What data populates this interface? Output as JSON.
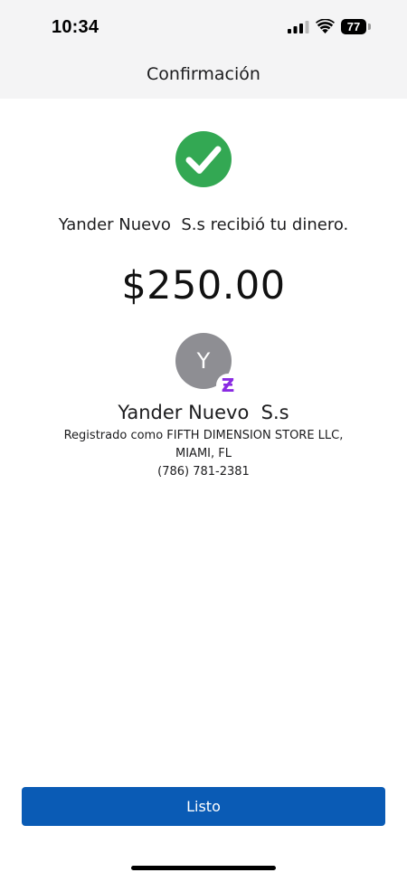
{
  "status_bar": {
    "time": "10:34",
    "battery": "77",
    "icons": [
      "signal-icon",
      "wifi-icon",
      "battery-icon"
    ]
  },
  "header": {
    "title": "Confirmación"
  },
  "confirmation": {
    "icon": "check-circle-icon",
    "icon_color": "#33a853",
    "message": "Yander Nuevo  S.s recibió tu dinero.",
    "amount": "$250.00"
  },
  "recipient": {
    "avatar_initial": "Y",
    "badge": "Ƶ",
    "badge_color": "#8a2be2",
    "name": "Yander Nuevo  S.s",
    "registered_as": "Registrado como FIFTH DIMENSION STORE LLC,",
    "location": "MIAMI, FL",
    "phone": "(786) 781-2381"
  },
  "actions": {
    "done_label": "Listo",
    "button_color": "#0a5bb5"
  }
}
